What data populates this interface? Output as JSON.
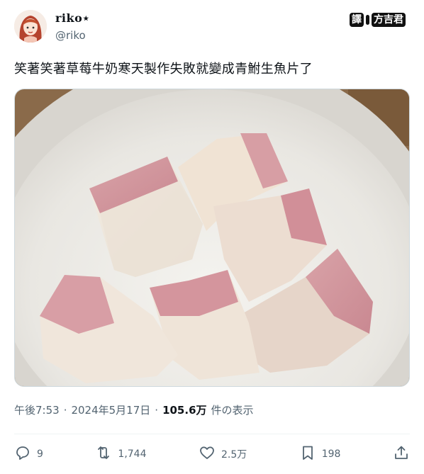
{
  "user": {
    "display_name": "riko⋆",
    "handle": "@riko"
  },
  "watermark": {
    "left": "譯",
    "right": "方吉君"
  },
  "tweet": {
    "text": "笑著笑著草莓牛奶寒天製作失敗就變成青鮒生魚片了"
  },
  "meta": {
    "time": "午後7:53",
    "date": "2024年5月17日",
    "views_count": "105.6万",
    "views_label": "件の表示"
  },
  "actions": {
    "replies": "9",
    "retweets": "1,744",
    "likes": "2.5万",
    "bookmarks": "198"
  },
  "icons": [
    "reply-icon",
    "retweet-icon",
    "like-icon",
    "bookmark-icon",
    "share-icon"
  ]
}
